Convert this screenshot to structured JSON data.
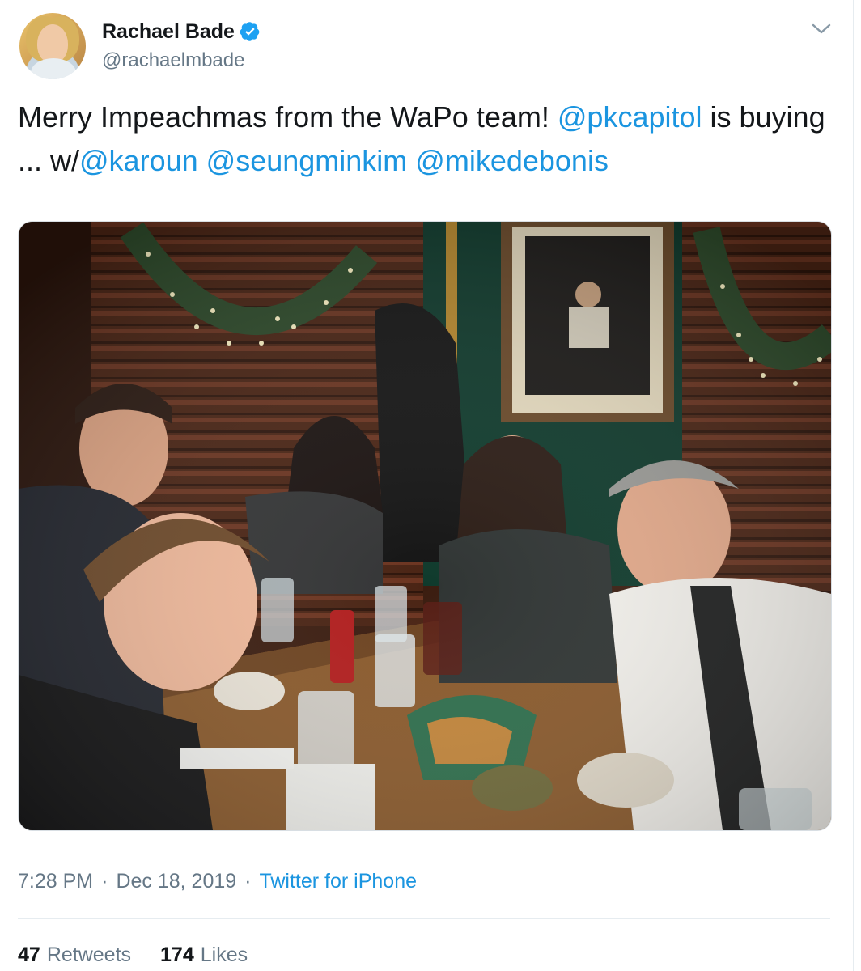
{
  "author": {
    "display_name": "Rachael Bade",
    "handle": "@rachaelmbade",
    "verified": true
  },
  "tweet": {
    "text_parts": [
      {
        "text": "Merry Impeachmas from the WaPo team! ",
        "type": "text"
      },
      {
        "text": "@pkcapitol",
        "type": "mention"
      },
      {
        "text": " is buying ... w/",
        "type": "text"
      },
      {
        "text": "@karoun",
        "type": "mention"
      },
      {
        "text": " ",
        "type": "text"
      },
      {
        "text": "@seungminkim",
        "type": "mention"
      },
      {
        "text": " ",
        "type": "text"
      },
      {
        "text": "@mikedebonis",
        "type": "mention"
      }
    ]
  },
  "meta": {
    "time": "7:28 PM",
    "separator": "·",
    "date": "Dec 18, 2019",
    "source": "Twitter for iPhone"
  },
  "stats": {
    "retweets_count": "47",
    "retweets_label": "Retweets",
    "likes_count": "174",
    "likes_label": "Likes"
  },
  "icons": {
    "verified": "verified-badge-icon",
    "caret": "chevron-down-icon"
  },
  "colors": {
    "link": "#1b95e0",
    "secondary_text": "#657786",
    "primary_text": "#14171a",
    "divider": "#e6ecf0"
  }
}
